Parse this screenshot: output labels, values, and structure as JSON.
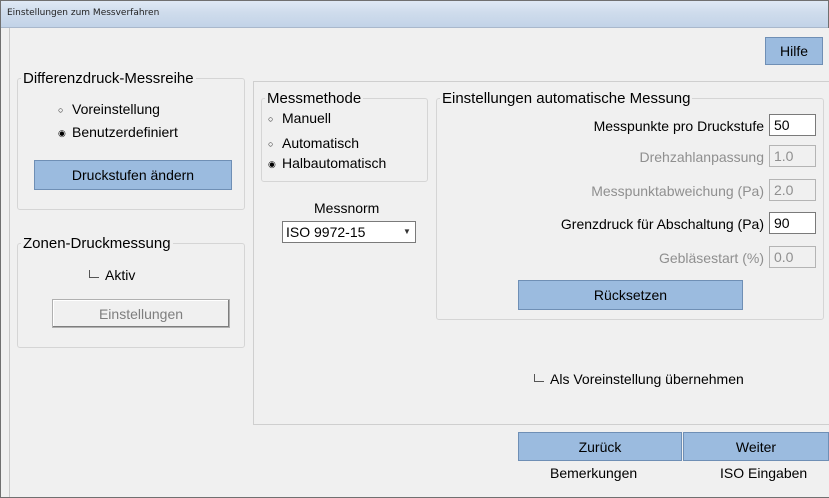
{
  "window": {
    "title": "Einstellungen zum Messverfahren"
  },
  "header": {
    "help_label": "Hilfe"
  },
  "diff_group": {
    "title": "Differenzdruck-Messreihe",
    "opt_preset": "Voreinstellung",
    "opt_custom": "Benutzerdefiniert",
    "selected": "Benutzerdefiniert",
    "change_button": "Druckstufen ändern"
  },
  "zone_group": {
    "title": "Zonen-Druckmessung",
    "active_label": "Aktiv",
    "active_checked": false,
    "settings_button": "Einstellungen"
  },
  "method_group": {
    "title": "Messmethode",
    "opt_manual": "Manuell",
    "opt_auto": "Automatisch",
    "opt_semi": "Halbautomatisch",
    "selected": "Halbautomatisch"
  },
  "norm": {
    "label": "Messnorm",
    "value": "ISO 9972-15"
  },
  "auto_group": {
    "title": "Einstellungen automatische Messung",
    "points_label": "Messpunkte pro Druckstufe",
    "points_value": "50",
    "rpm_label": "Drehzahlanpassung",
    "rpm_value": "1.0",
    "deviation_label": "Messpunktabweichung (Pa)",
    "deviation_value": "2.0",
    "limit_label": "Grenzdruck für Abschaltung (Pa)",
    "limit_value": "90",
    "fan_label": "Gebläsestart (%)",
    "fan_value": "0.0",
    "reset_button": "Rücksetzen"
  },
  "save_default": {
    "label": "Als Voreinstellung übernehmen",
    "checked": false
  },
  "footer": {
    "back_button": "Zurück",
    "next_button": "Weiter",
    "back_caption": "Bemerkungen",
    "next_caption": "ISO Eingaben"
  },
  "colors": {
    "button_blue": "#9bbbdf",
    "window_bg": "#f0f0f0"
  }
}
